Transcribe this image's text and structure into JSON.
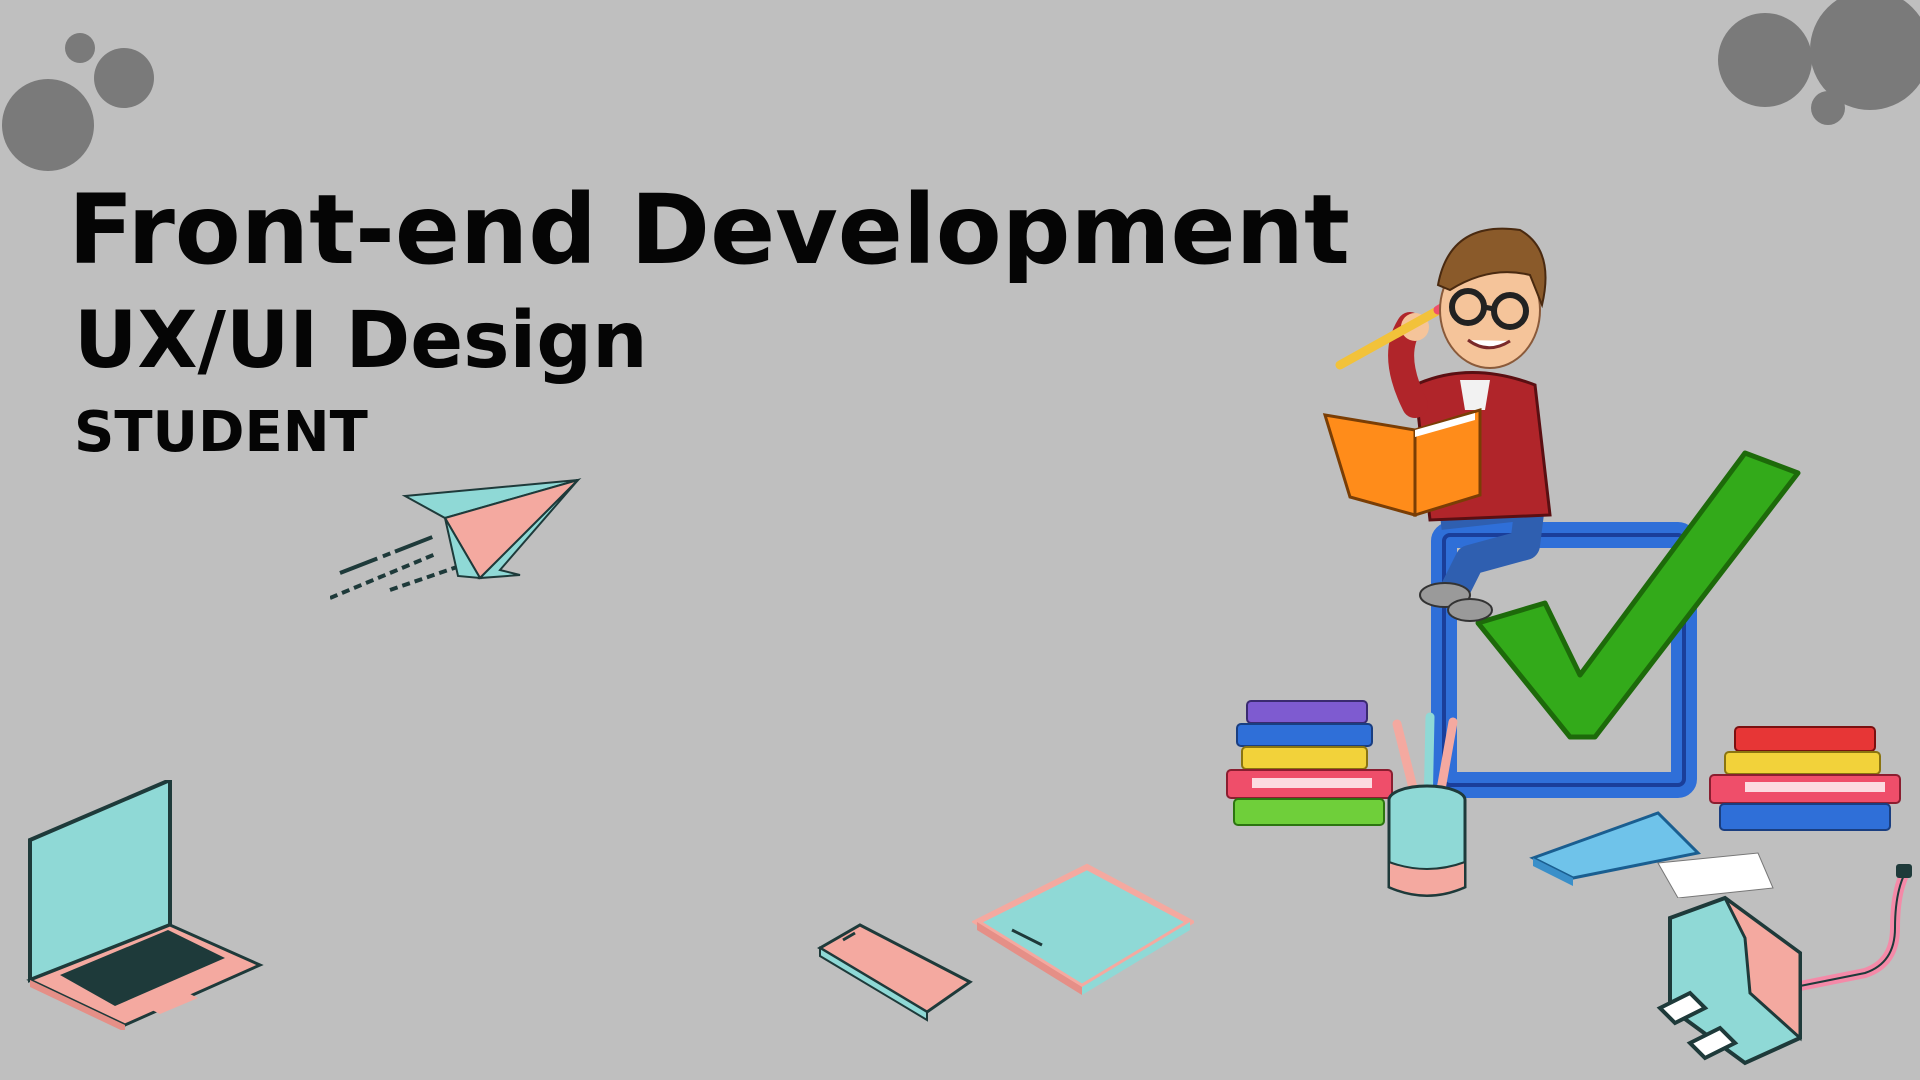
{
  "slide": {
    "title": "Front-end Development",
    "subtitle": "UX/UI Design",
    "role": "STUDENT"
  },
  "colors": {
    "background": "#bfbfbf",
    "text": "#050505",
    "bubble": "#7a7a7a",
    "teal": "#8fd9d6",
    "pink": "#f4a9a0",
    "dark": "#1e3a3a",
    "check_green": "#33aa1a",
    "box_blue": "#2f6fd8"
  },
  "icons": [
    "bubbles-top-left-icon",
    "bubbles-top-right-icon",
    "paper-plane-icon",
    "laptop-icon",
    "phone-icon",
    "tablet-icon",
    "student-avatar-illustration",
    "checkbox-checkmark-icon",
    "book-stack-icon",
    "pencil-cup-icon",
    "binder-icon",
    "power-plug-icon"
  ]
}
